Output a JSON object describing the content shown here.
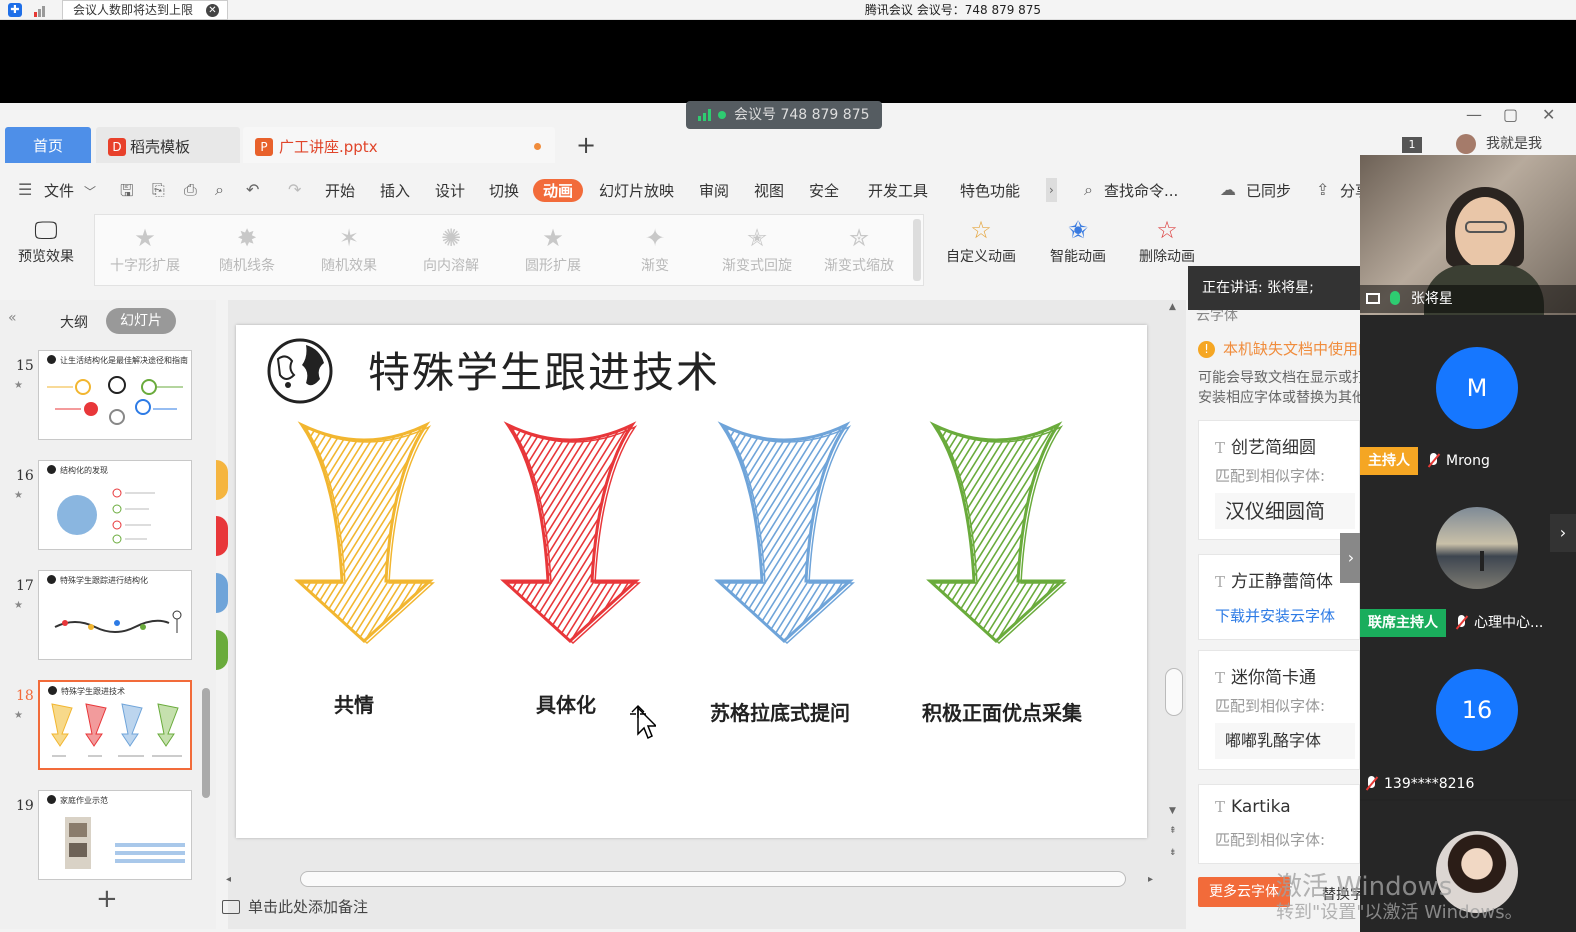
{
  "meeting_topbar": {
    "notice": "会议人数即将达到上限",
    "title": "腾讯会议 会议号：748 879 875"
  },
  "meeting_id_pill": "会议号 748 879 875",
  "tabs": {
    "home": "首页",
    "template": "稻壳模板",
    "document": "广工讲座.pptx",
    "template_icon": "D",
    "document_icon": "P"
  },
  "window": {
    "count_badge": "1",
    "user": "我就是我"
  },
  "menubar": {
    "file": "文件",
    "items": [
      "开始",
      "插入",
      "设计",
      "切换",
      "动画",
      "幻灯片放映",
      "审阅",
      "视图",
      "安全",
      "开发工具",
      "特色功能"
    ],
    "search": "查找命令...",
    "synced": "已同步",
    "share": "分享"
  },
  "ribbon": {
    "preview": "预览效果",
    "effects": [
      "十字形扩展",
      "随机线条",
      "随机效果",
      "向内溶解",
      "圆形扩展",
      "渐变",
      "渐变式回旋",
      "渐变式缩放"
    ],
    "custom": "自定义动画",
    "smart": "智能动画",
    "delete": "删除动画"
  },
  "left_panel": {
    "outline": "大纲",
    "slides": "幻灯片",
    "thumbnails": [
      {
        "num": "15",
        "title": "让生活结构化是最佳解决途径和指南"
      },
      {
        "num": "16",
        "title": "结构化的发现"
      },
      {
        "num": "17",
        "title": "特殊学生跟踪进行结构化"
      },
      {
        "num": "18",
        "title": "特殊学生跟进技术"
      },
      {
        "num": "19",
        "title": "家庭作业示范"
      }
    ]
  },
  "slide": {
    "title": "特殊学生跟进技术",
    "labels": [
      "共情",
      "具体化",
      "苏格拉底式提问",
      "积极正面优点采集"
    ],
    "arrow_colors": [
      "#f2b630",
      "#e8373a",
      "#6fa4d9",
      "#6aab3c"
    ]
  },
  "notes_placeholder": "单击此处添加备注",
  "font_panel": {
    "speaking": "正在讲话: 张将星;",
    "cloud_font": "云字体",
    "missing": "本机缺失文档中使用的字体",
    "desc_line1": "可能会导致文档在显示或打印时",
    "desc_line2": "安装相应字体或替换为其他字体",
    "cards": [
      {
        "name": "创艺简细圆",
        "sub": "匹配到相似字体:",
        "match": "汉仪细圆简"
      },
      {
        "name": "方正静蕾简体",
        "link": "下载并安装云字体"
      },
      {
        "name": "迷你简卡通",
        "sub": "匹配到相似字体:",
        "match": "嘟嘟乳酪字体"
      },
      {
        "name": "Kartika",
        "sub": "匹配到相似字体:"
      }
    ],
    "more": "更多云字体",
    "replace": "替换字体"
  },
  "videos": {
    "speaker": "张将星",
    "p1_letter": "M",
    "p1_role": "主持人",
    "p1_name": "Mrong",
    "p2_role": "联席主持人",
    "p2_name": "心理中心...",
    "p3_letter": "16",
    "p3_name": "139****8216",
    "role_colors": {
      "host": "#f5a623",
      "cohost": "#1aad5c"
    }
  },
  "watermark": {
    "line1": "激活 Windows",
    "line2": "转到\"设置\"以激活 Windows。"
  }
}
